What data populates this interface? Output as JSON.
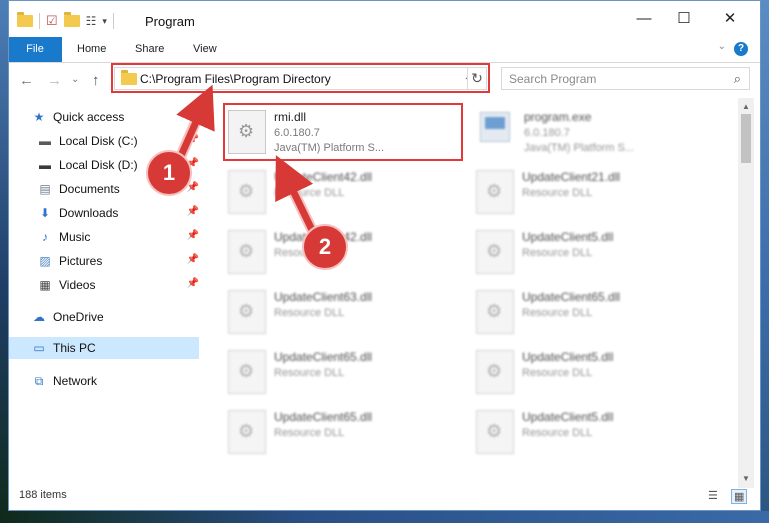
{
  "window": {
    "title": "Program",
    "controls": {
      "minimize": "—",
      "maximize": "☐",
      "close": "✕"
    }
  },
  "ribbon": {
    "tabs": [
      "File",
      "Home",
      "Share",
      "View"
    ],
    "help": "?",
    "expand": "⌄"
  },
  "nav": {
    "back": "←",
    "forward": "→",
    "dropdown": "⌄",
    "up": "↑",
    "address": "C:\\Program Files\\Program Directory",
    "address_dropdown": "⌄",
    "refresh": "↻",
    "search_placeholder": "Search Program",
    "search_icon": "⌕"
  },
  "sidebar": {
    "items": [
      {
        "label": "Quick access",
        "icon": "star-icon",
        "glyph": "★",
        "color": "#2f74c9",
        "pinned": false,
        "selected": false
      },
      {
        "label": "Local Disk (C:)",
        "icon": "drive-icon",
        "glyph": "▬",
        "color": "#5a5a5a",
        "pinned": true,
        "selected": false
      },
      {
        "label": "Local Disk (D:)",
        "icon": "drive-icon",
        "glyph": "▬",
        "color": "#3a3a3a",
        "pinned": true,
        "selected": false
      },
      {
        "label": "Documents",
        "icon": "documents-icon",
        "glyph": "▤",
        "color": "#6a7c92",
        "pinned": true,
        "selected": false
      },
      {
        "label": "Downloads",
        "icon": "downloads-icon",
        "glyph": "⬇",
        "color": "#2f74c9",
        "pinned": true,
        "selected": false
      },
      {
        "label": "Music",
        "icon": "music-icon",
        "glyph": "♪",
        "color": "#2f74c9",
        "pinned": true,
        "selected": false
      },
      {
        "label": "Pictures",
        "icon": "pictures-icon",
        "glyph": "▨",
        "color": "#4f86c4",
        "pinned": true,
        "selected": false
      },
      {
        "label": "Videos",
        "icon": "videos-icon",
        "glyph": "▦",
        "color": "#444444",
        "pinned": true,
        "selected": false
      },
      {
        "label": "OneDrive",
        "icon": "onedrive-icon",
        "glyph": "☁",
        "color": "#2f74c9",
        "pinned": false,
        "selected": false
      },
      {
        "label": "This PC",
        "icon": "pc-icon",
        "glyph": "▭",
        "color": "#2f74c9",
        "pinned": false,
        "selected": true
      },
      {
        "label": "Network",
        "icon": "network-icon",
        "glyph": "⧉",
        "color": "#2f74c9",
        "pinned": false,
        "selected": false
      }
    ]
  },
  "files": {
    "highlighted": {
      "name": "rmi.dll",
      "version": "6.0.180.7",
      "description": "Java(TM) Platform S..."
    },
    "program_exe": {
      "name": "program.exe",
      "version": "6.0.180.7",
      "description": "Java(TM) Platform S..."
    },
    "left_column": [
      {
        "name": "UpdateClient42.dll",
        "description": "Resource DLL"
      },
      {
        "name": "UpdateClient42.dll",
        "description": "Resource DLL"
      },
      {
        "name": "UpdateClient63.dll",
        "description": "Resource DLL"
      },
      {
        "name": "UpdateClient65.dll",
        "description": "Resource DLL"
      },
      {
        "name": "UpdateClient65.dll",
        "description": "Resource DLL"
      }
    ],
    "right_column": [
      {
        "name": "UpdateClient21.dll",
        "description": "Resource DLL"
      },
      {
        "name": "UpdateClient5.dll",
        "description": "Resource DLL"
      },
      {
        "name": "UpdateClient65.dll",
        "description": "Resource DLL"
      },
      {
        "name": "UpdateClient5.dll",
        "description": "Resource DLL"
      },
      {
        "name": "UpdateClient5.dll",
        "description": "Resource DLL"
      }
    ]
  },
  "status": {
    "item_count": "188 items"
  },
  "callouts": {
    "one": "1",
    "two": "2",
    "color": "#d73a36"
  }
}
